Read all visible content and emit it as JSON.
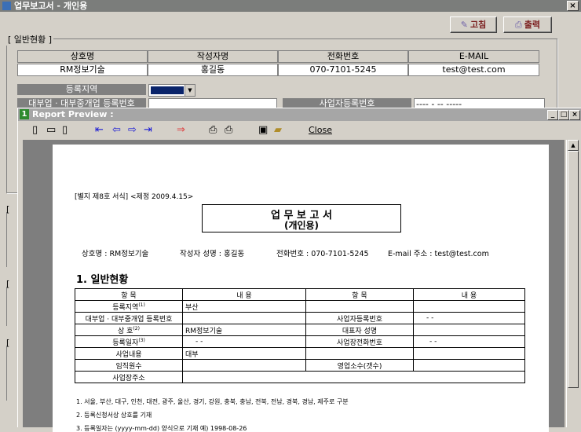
{
  "back_window": {
    "title": "업무보고서 - 개인용",
    "close": "×",
    "toolbar": {
      "button1_icon": "✎",
      "button1_label": "고침",
      "button2_icon": "⎙",
      "button2_label": "출력"
    },
    "group_label": "[ 일반현황 ]",
    "headers": [
      "상호명",
      "작성자명",
      "전화번호",
      "E-MAIL"
    ],
    "values": [
      "RM정보기술",
      "홍길동",
      "070-7101-5245",
      "test@test.com"
    ],
    "region_label": "등록지역",
    "region_value": "",
    "biz_type_label": "대부업 · 대부중개업 등록번호",
    "biz_reg_label": "사업자등록번호",
    "biz_reg_value": "---- - -- -----",
    "side_bracket": "["
  },
  "preview_window": {
    "title": "Report Preview :",
    "min": "_",
    "max": "□",
    "close": "×",
    "close_label": "Close"
  },
  "report": {
    "form_note": "[별지 제8호 서식] <제정 2009.4.15>",
    "title": "업 무 보 고 서",
    "subtitle": "(개인용)",
    "company": "상호명 : RM정보기술",
    "writer": "작성자 성명 : 홍길동",
    "phone": "전화번호 : 070-7101-5245",
    "email": "E-mail 주소 : test@test.com",
    "section": "1. 일반현황",
    "col_item": "항      목",
    "col_content": "내          용",
    "rows": [
      {
        "l": "등록지역",
        "lsup": "(1)",
        "lv": "부산",
        "r": "",
        "rv": ""
      },
      {
        "l": "대부업 · 대부중개업 등록번호",
        "lsup": "",
        "lv": "",
        "r": "사업자등록번호",
        "rv": "-  -"
      },
      {
        "l": "상      호",
        "lsup": "(2)",
        "lv": "RM정보기술",
        "r": "대표자 성명",
        "rv": ""
      },
      {
        "l": "등록일자",
        "lsup": "(3)",
        "lv": "-  -",
        "r": "사업장전화번호",
        "rv": "-  -"
      },
      {
        "l": "사업내용",
        "lsup": "",
        "lv": "대부",
        "r": "",
        "rv": ""
      },
      {
        "l": "임직원수",
        "lsup": "",
        "lv": "",
        "r": "영업소수(갯수)",
        "rv": ""
      },
      {
        "l": "사업장주소",
        "lsup": "",
        "lv": "",
        "r": "",
        "rv": ""
      }
    ],
    "notes": [
      "1. 서울, 부산, 대구, 인천, 대전, 광주, 울산, 경기, 강원, 충북, 충남, 전북, 전남, 경북, 경남, 제주로 구분",
      "2. 등록신청서상 상호를 기재",
      "3. 등록일자는 (yyyy-mm-dd) 양식으로 기재  예) 1998-08-26"
    ]
  }
}
